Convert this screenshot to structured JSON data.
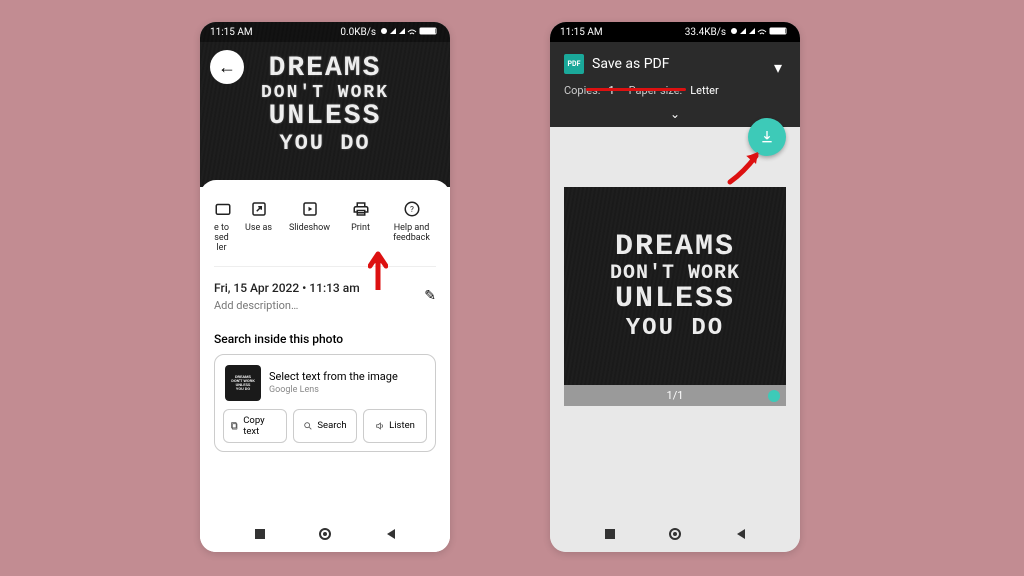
{
  "colors": {
    "background": "#c28c92",
    "accent_teal": "#3dcab8",
    "annotation_red": "#d11a1a"
  },
  "left": {
    "status": {
      "time": "11:15 AM",
      "rate": "0.0KB/s",
      "icons_text": "⏰ 📶 📶 🛜 92"
    },
    "hero": {
      "line1": "DREAMS",
      "line2": "DON'T WORK",
      "line3": "UNLESS",
      "line4": "YOU DO"
    },
    "back_icon": "←",
    "actions": {
      "clipped": "e to\nsed\nler",
      "use_as": "Use as",
      "slideshow": "Slideshow",
      "print": "Print",
      "help": "Help and\nfeedback"
    },
    "meta": {
      "date": "Fri, 15 Apr 2022  •  11:13 am",
      "description_placeholder": "Add description…"
    },
    "edit_glyph": "✎",
    "search": {
      "label": "Search inside this photo",
      "title": "Select text from the image",
      "subtitle": "Google Lens",
      "copy": "Copy text",
      "search_chip": "Search",
      "listen": "Listen"
    },
    "print_arrow_color": "#d11a1a"
  },
  "right": {
    "status": {
      "time": "11:15 AM",
      "rate": "33.4KB/s",
      "icons_text": "⏰ 📶 📶 🛜 92"
    },
    "print_header": {
      "destination": "Save as PDF",
      "copies_label": "Copies:",
      "copies_value": "1",
      "size_label": "Paper size:",
      "size_value": "Letter"
    },
    "expand_glyph": "⌄",
    "dropdown_glyph": "▾",
    "preview": {
      "line1": "DREAMS",
      "line2": "DON'T WORK",
      "line3": "UNLESS",
      "line4": "YOU DO",
      "page_counter": "1/1"
    }
  }
}
